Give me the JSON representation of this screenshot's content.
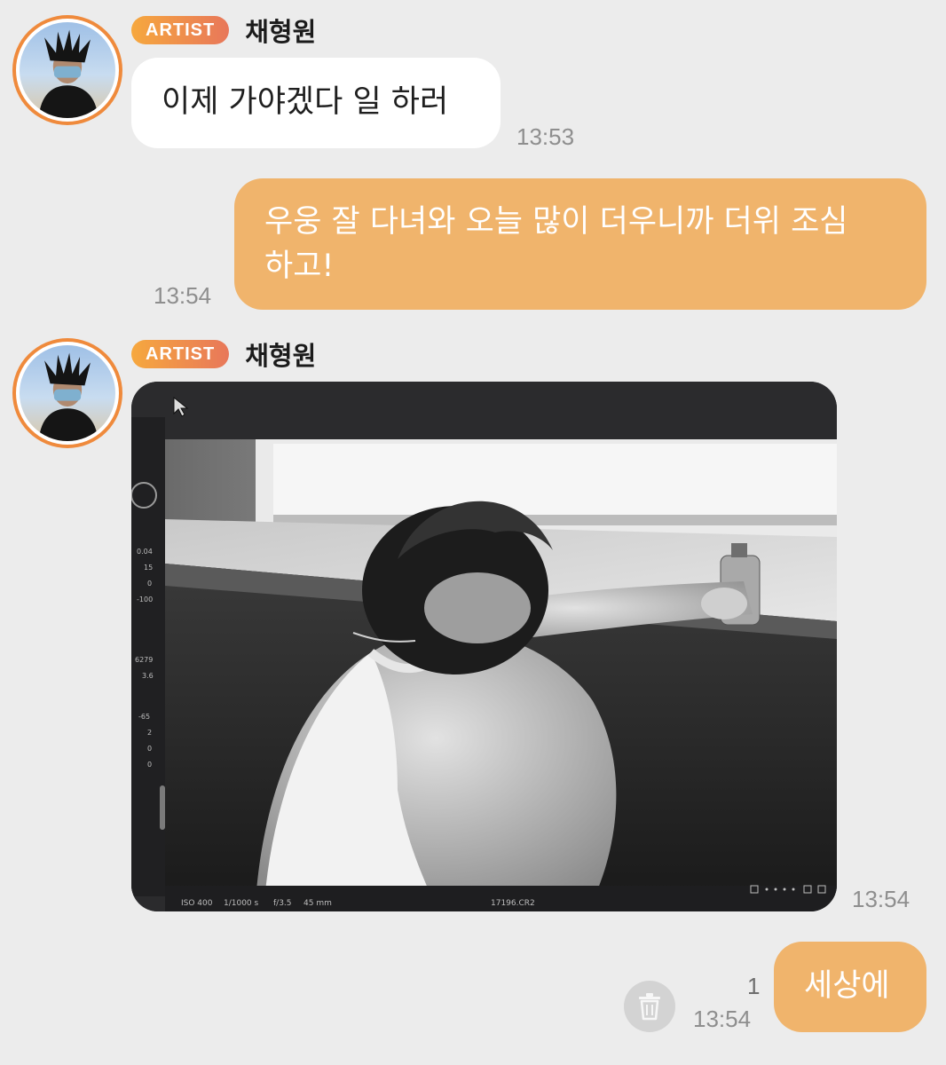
{
  "messages": [
    {
      "sender": {
        "badge": "ARTIST",
        "name": "채형원"
      },
      "text": "이제 가야겠다 일 하러",
      "time": "13:53"
    },
    {
      "outgoing": true,
      "text_line1": "우웅 잘 다녀와 오늘 많이 더우니까 더위 조심",
      "text_line2": "하고!",
      "time": "13:54"
    },
    {
      "sender": {
        "badge": "ARTIST",
        "name": "채형원"
      },
      "photo": {
        "description_icon": "photo-on-monitor",
        "editor_values": [
          "0.04",
          "15",
          "0",
          "-100",
          "6279",
          "3.6",
          "-65",
          "2",
          "0",
          "0"
        ],
        "status_bar": {
          "iso": "ISO 400",
          "shutter": "1/1000 s",
          "aperture": "f/3.5",
          "focal": "45 mm",
          "file": "17196.CR2"
        }
      },
      "time": "13:54"
    },
    {
      "outgoing": true,
      "text": "세상에",
      "unread_count": "1",
      "time": "13:54",
      "delete_icon": "trash-icon"
    }
  ],
  "colors": {
    "background": "#ececec",
    "outgoing_bubble": "#f0b46c",
    "badge_start": "#f6a83e",
    "badge_end": "#e8775a",
    "avatar_ring": "#ef8a3c"
  }
}
